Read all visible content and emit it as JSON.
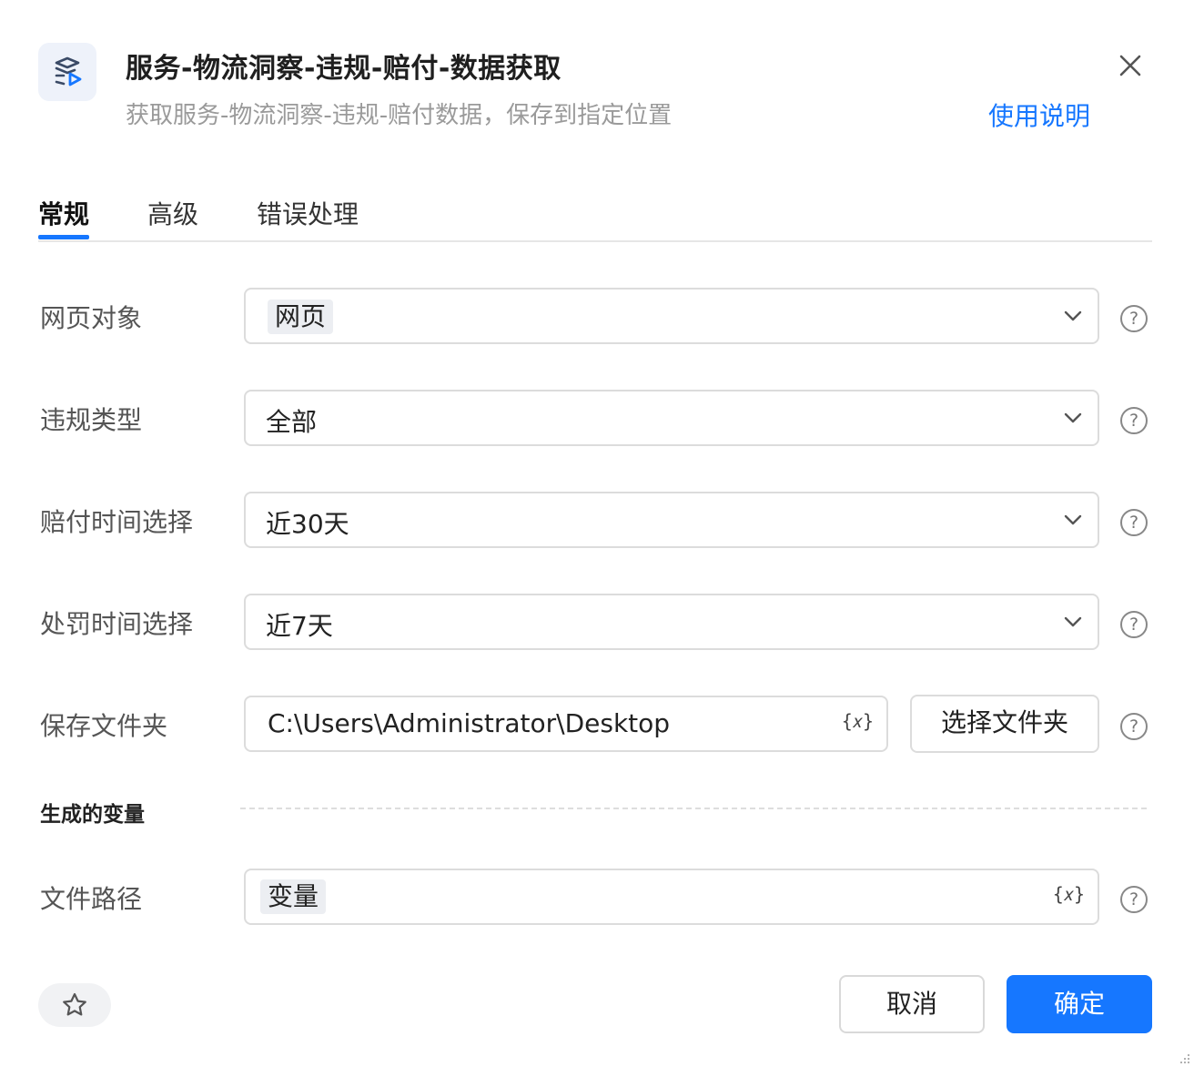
{
  "header": {
    "title": "服务-物流洞察-违规-赔付-数据获取",
    "subtitle": "获取服务-物流洞察-违规-赔付数据，保存到指定位置",
    "help_link": "使用说明",
    "icon": "app-logo-icon",
    "close_icon": "close-icon"
  },
  "tabs": [
    {
      "label": "常规",
      "active": true
    },
    {
      "label": "高级",
      "active": false
    },
    {
      "label": "错误处理",
      "active": false
    }
  ],
  "form": {
    "web_object": {
      "label": "网页对象",
      "value": "网页"
    },
    "violation_type": {
      "label": "违规类型",
      "value": "全部"
    },
    "payout_time": {
      "label": "赔付时间选择",
      "value": "近30天"
    },
    "penalty_time": {
      "label": "处罚时间选择",
      "value": "近7天"
    },
    "save_folder": {
      "label": "保存文件夹",
      "value": "C:\\Users\\Administrator\\Desktop",
      "var_symbol": "{𝑥}",
      "select_button": "选择文件夹"
    },
    "help_symbol": "?"
  },
  "output_section": {
    "title": "生成的变量",
    "file_path": {
      "label": "文件路径",
      "value": "变量",
      "var_symbol": "{𝑥}"
    }
  },
  "footer": {
    "favorite_icon": "star-icon",
    "cancel": "取消",
    "confirm": "确定"
  },
  "colors": {
    "accent": "#1677ff",
    "chip_bg": "#eceef2",
    "border": "#dcdcdc"
  }
}
